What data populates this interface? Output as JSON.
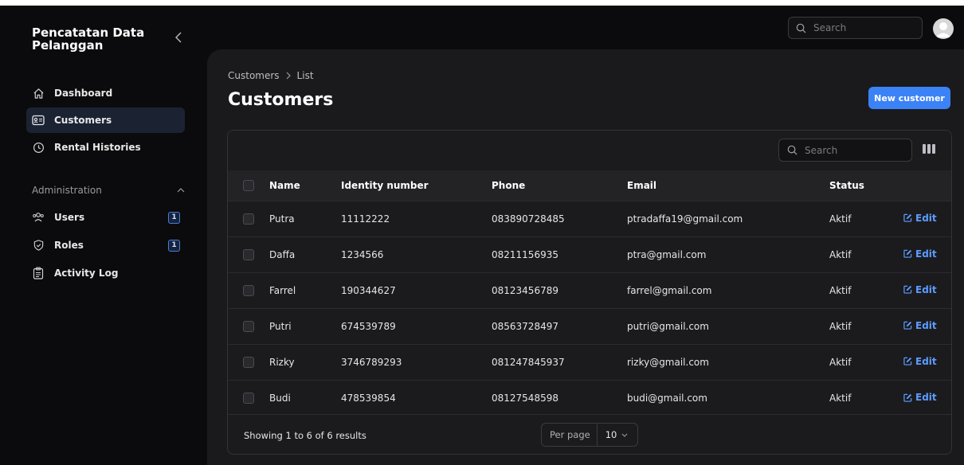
{
  "app": {
    "brand": "Pencatatan Data Pelanggan"
  },
  "sidebar": {
    "items": [
      {
        "label": "Dashboard",
        "icon": "home-icon"
      },
      {
        "label": "Customers",
        "icon": "id-card-icon",
        "active": true
      },
      {
        "label": "Rental Histories",
        "icon": "clock-icon"
      }
    ],
    "admin_section": {
      "label": "Administration",
      "items": [
        {
          "label": "Users",
          "icon": "users-icon",
          "badge": "1"
        },
        {
          "label": "Roles",
          "icon": "shield-check-icon",
          "badge": "1"
        },
        {
          "label": "Activity Log",
          "icon": "clipboard-icon"
        }
      ]
    }
  },
  "topbar": {
    "search_placeholder": "Search"
  },
  "main": {
    "breadcrumb": [
      "Customers",
      "List"
    ],
    "title": "Customers",
    "new_button": "New customer"
  },
  "table": {
    "search_placeholder": "Search",
    "columns": [
      "Name",
      "Identity number",
      "Phone",
      "Email",
      "Status"
    ],
    "edit_label": "Edit",
    "rows": [
      {
        "name": "Putra",
        "identity": "11112222",
        "phone": "083890728485",
        "email": "ptradaffa19@gmail.com",
        "status": "Aktif"
      },
      {
        "name": "Daffa",
        "identity": "1234566",
        "phone": "08211156935",
        "email": "ptra@gmail.com",
        "status": "Aktif"
      },
      {
        "name": "Farrel",
        "identity": "190344627",
        "phone": "08123456789",
        "email": "farrel@gmail.com",
        "status": "Aktif"
      },
      {
        "name": "Putri",
        "identity": "674539789",
        "phone": "08563728497",
        "email": "putri@gmail.com",
        "status": "Aktif"
      },
      {
        "name": "Rizky",
        "identity": "3746789293",
        "phone": "081247845937",
        "email": "rizky@gmail.com",
        "status": "Aktif"
      },
      {
        "name": "Budi",
        "identity": "478539854",
        "phone": "08127548598",
        "email": "budi@gmail.com",
        "status": "Aktif"
      }
    ],
    "footer": {
      "showing": "Showing 1 to 6 of 6 results",
      "per_page_label": "Per page",
      "per_page_value": "10"
    }
  },
  "colors": {
    "accent": "#3b82f6",
    "link": "#5d9cff",
    "background": "#0b0b0d",
    "panel": "#1a1a1d"
  }
}
